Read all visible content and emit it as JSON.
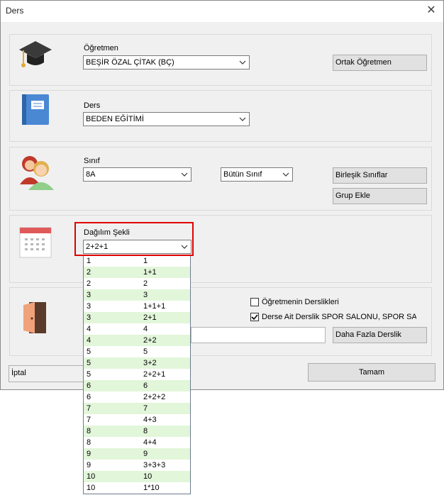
{
  "window": {
    "title": "Ders",
    "close_glyph": "✕"
  },
  "teacher": {
    "label": "Öğretmen",
    "value": "BEŞİR ÖZAL ÇİTAK (BÇ)",
    "co_teacher_button": "Ortak Öğretmen",
    "icon": "graduation-cap-icon"
  },
  "lesson": {
    "label": "Ders",
    "value": "BEDEN EĞİTİMİ",
    "icon": "book-icon"
  },
  "class_section": {
    "label": "Sınıf",
    "value": "8A",
    "scope_value": "Bütün Sınıf",
    "merge_button": "Birleşik Sınıflar",
    "group_button": "Grup Ekle",
    "icon": "students-icon"
  },
  "distribution": {
    "label": "Dağılım Şekli",
    "value": "2+2+1",
    "icon": "calendar-icon",
    "options": [
      [
        "1",
        "1"
      ],
      [
        "2",
        "1+1"
      ],
      [
        "2",
        "2"
      ],
      [
        "3",
        "3"
      ],
      [
        "3",
        "1+1+1"
      ],
      [
        "3",
        "2+1"
      ],
      [
        "4",
        "4"
      ],
      [
        "4",
        "2+2"
      ],
      [
        "5",
        "5"
      ],
      [
        "5",
        "3+2"
      ],
      [
        "5",
        "2+2+1"
      ],
      [
        "6",
        "6"
      ],
      [
        "6",
        "2+2+2"
      ],
      [
        "7",
        "7"
      ],
      [
        "7",
        "4+3"
      ],
      [
        "8",
        "8"
      ],
      [
        "8",
        "4+4"
      ],
      [
        "9",
        "9"
      ],
      [
        "9",
        "3+3+3"
      ],
      [
        "10",
        "10"
      ],
      [
        "10",
        "1*10"
      ]
    ]
  },
  "classroom": {
    "teacher_rooms_label": "Öğretmenin Derslikleri",
    "teacher_rooms_checked": false,
    "lesson_rooms_label": "Derse Ait Derslik SPOR SALONU, SPOR SALON",
    "lesson_rooms_checked": true,
    "more_rooms_button": "Daha Fazla Derslik",
    "icon": "door-icon"
  },
  "footer": {
    "cancel": "İptal",
    "ok": "Tamam"
  },
  "colors": {
    "highlight": "#e00000",
    "alt_row": "#e2f6da"
  }
}
